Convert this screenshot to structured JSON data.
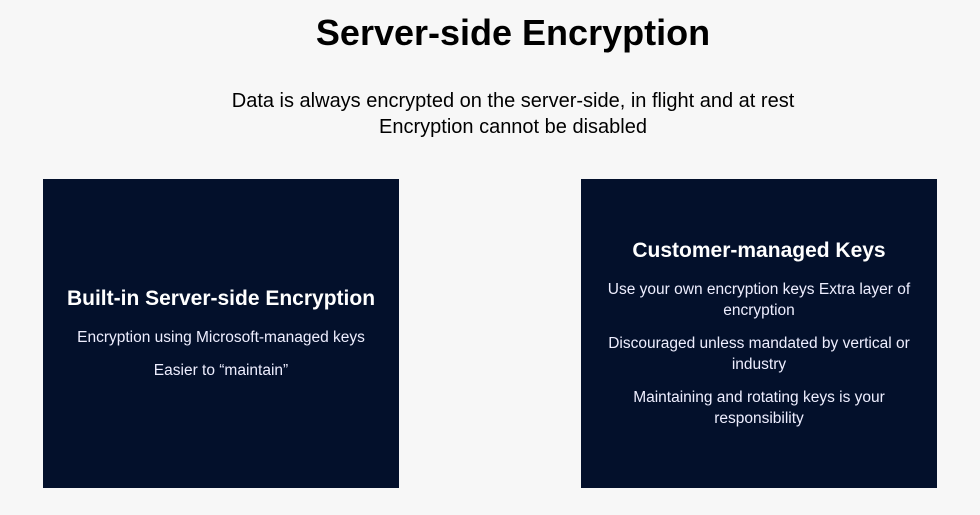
{
  "slide": {
    "title": "Server-side Encryption",
    "subtitle_lines": [
      "Data is always encrypted on the server-side, in flight and at rest",
      "Encryption cannot be disabled"
    ]
  },
  "boxes": [
    {
      "heading": "Built-in Server-side Encryption",
      "points": [
        "Encryption using Microsoft-managed keys",
        "Easier to “maintain”"
      ]
    },
    {
      "heading": "Customer-managed Keys",
      "points": [
        "Use your own encryption keys Extra layer of encryption",
        "Discouraged unless mandated by vertical or industry",
        "Maintaining and rotating keys is your responsibility"
      ]
    }
  ],
  "colors": {
    "background": "#f7f7f7",
    "box": "#03102b"
  }
}
